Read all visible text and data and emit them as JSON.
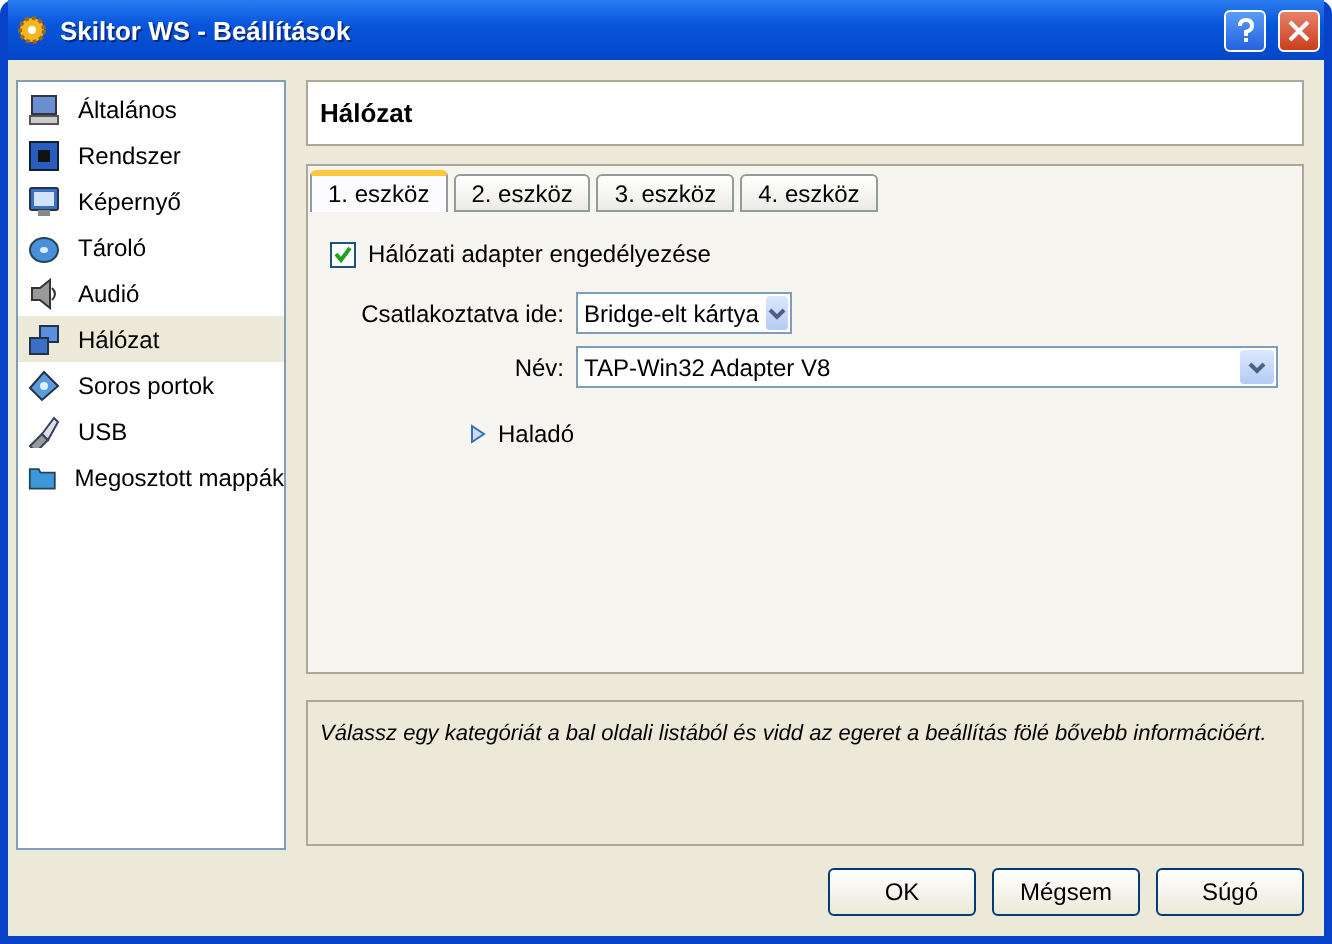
{
  "window": {
    "title": "Skiltor WS - Beállítások"
  },
  "sidebar": {
    "items": [
      {
        "label": "Általános",
        "selected": false
      },
      {
        "label": "Rendszer",
        "selected": false
      },
      {
        "label": "Képernyő",
        "selected": false
      },
      {
        "label": "Tároló",
        "selected": false
      },
      {
        "label": "Audió",
        "selected": false
      },
      {
        "label": "Hálózat",
        "selected": true
      },
      {
        "label": "Soros portok",
        "selected": false
      },
      {
        "label": "USB",
        "selected": false
      },
      {
        "label": "Megosztott mappák",
        "selected": false
      }
    ]
  },
  "section_title": "Hálózat",
  "tabs": [
    {
      "label": "1. eszköz",
      "selected": true
    },
    {
      "label": "2. eszköz",
      "selected": false
    },
    {
      "label": "3. eszköz",
      "selected": false
    },
    {
      "label": "4. eszköz",
      "selected": false
    }
  ],
  "adapter_enabled": {
    "label": "Hálózati adapter engedélyezése",
    "checked": true
  },
  "attached_to": {
    "label": "Csatlakoztatva ide:",
    "value": "Bridge-elt kártya"
  },
  "adapter_name": {
    "label": "Név:",
    "value": "TAP-Win32 Adapter V8"
  },
  "advanced": {
    "label": "Haladó",
    "expanded": false
  },
  "info": "Válassz egy kategóriát a bal oldali listából és vidd az egeret a beállítás fölé bővebb információért.",
  "buttons": [
    "OK",
    "Mégsem",
    "Súgó"
  ]
}
